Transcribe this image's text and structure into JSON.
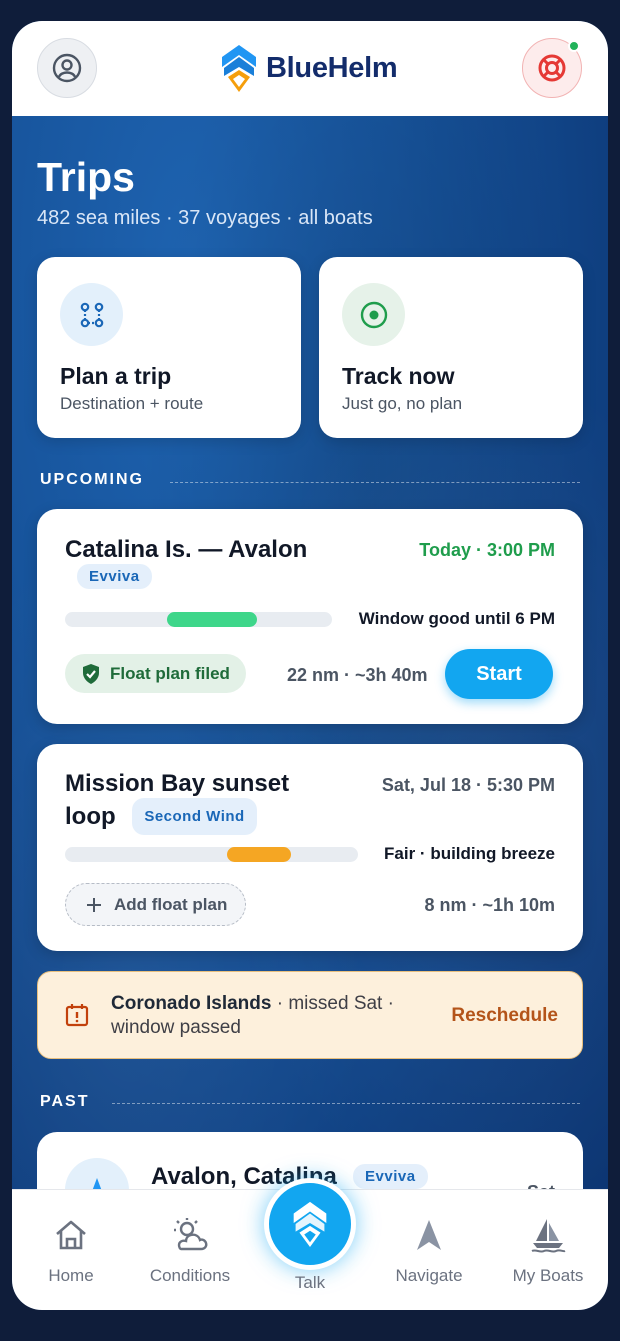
{
  "header": {
    "brand": "BlueHelm"
  },
  "page": {
    "title": "Trips",
    "subtitle": "482 sea miles · 37 voyages · all boats"
  },
  "actions": [
    {
      "title": "Plan a trip",
      "subtitle": "Destination + route",
      "icon": "route-icon"
    },
    {
      "title": "Track now",
      "subtitle": "Just go, no plan",
      "icon": "target-icon"
    }
  ],
  "upcoming": {
    "label": "UPCOMING",
    "trips": [
      {
        "name": "Catalina Is. — Avalon",
        "boat": "Evviva",
        "when": "Today · 3:00 PM",
        "window_text": "Window good until 6 PM",
        "window_color": "#3ed68a",
        "float_plan": "Float plan filed",
        "meta": "22 nm · ~3h 40m",
        "action": "Start"
      },
      {
        "name_line1": "Mission Bay sunset",
        "name_line2": "loop",
        "boat": "Second Wind",
        "when": "Sat, Jul 18 · 5:30 PM",
        "window_text": "Fair · building breeze",
        "window_color": "#f5a623",
        "float_plan": "Add float plan",
        "meta": "8 nm · ~1h 10m"
      }
    ],
    "missed": {
      "place": "Coronado Islands",
      "detail": " · missed Sat · window passed",
      "action": "Reschedule"
    }
  },
  "past": {
    "label": "PAST",
    "trips": [
      {
        "name": "Avalon, Catalina",
        "boat": "Evviva",
        "when": "Sat"
      }
    ]
  },
  "tabs": [
    {
      "label": "Home",
      "icon": "home-icon"
    },
    {
      "label": "Conditions",
      "icon": "weather-icon"
    },
    {
      "label": "Talk",
      "icon": "helm-logo-icon"
    },
    {
      "label": "Navigate",
      "icon": "navigation-arrow-icon"
    },
    {
      "label": "My Boats",
      "icon": "sailboat-icon"
    }
  ],
  "colors": {
    "accent": "#12a6f0",
    "brand": "#132c6b",
    "good": "#1f9d4c",
    "warning": "#b4541a"
  }
}
